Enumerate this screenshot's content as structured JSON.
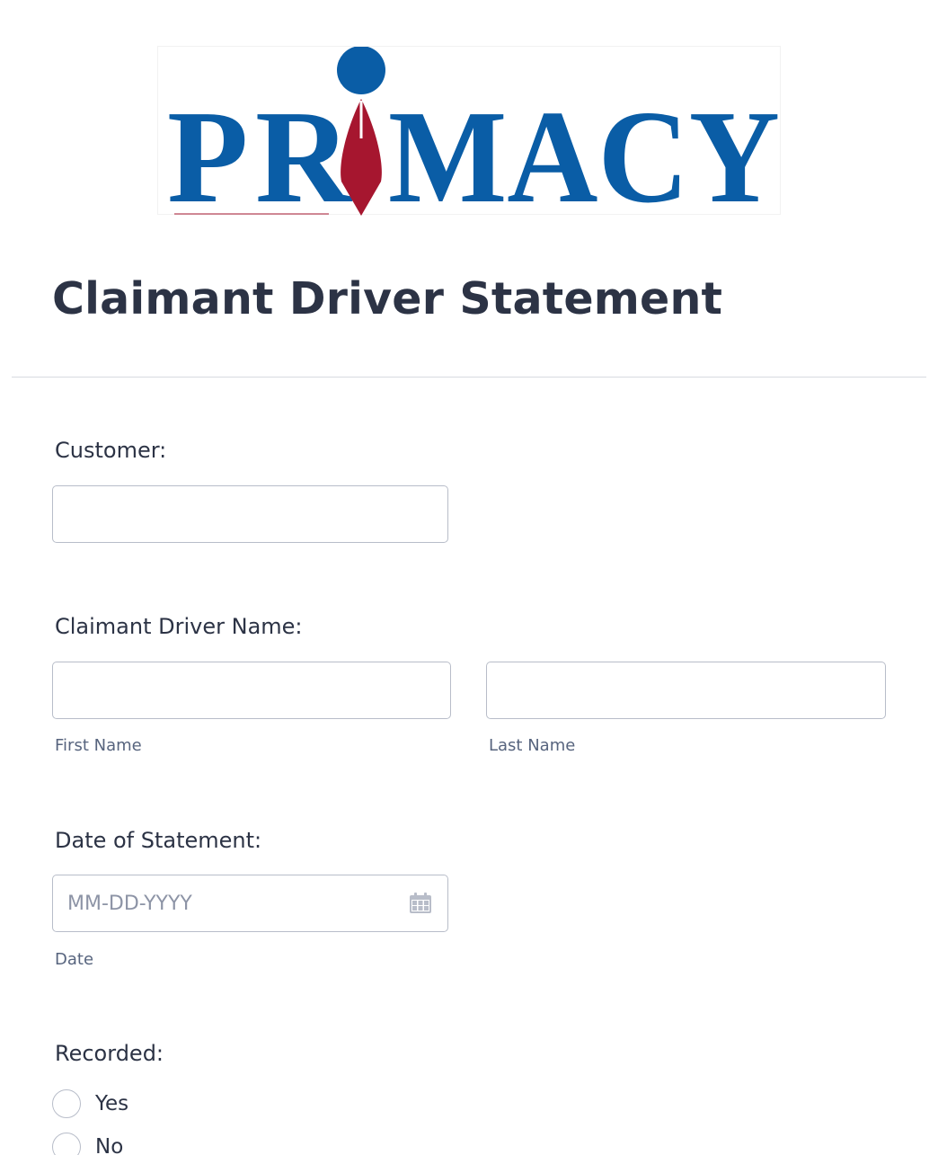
{
  "logo": {
    "text": "PRIMACY",
    "blue": "#0a5da6",
    "red": "#a6162f"
  },
  "form": {
    "title": "Claimant Driver Statement"
  },
  "customer": {
    "label": "Customer:",
    "value": ""
  },
  "claimant_name": {
    "label": "Claimant Driver Name:",
    "first_sublabel": "First Name",
    "last_sublabel": "Last Name",
    "first_value": "",
    "last_value": ""
  },
  "date_of_statement": {
    "label": "Date of Statement:",
    "placeholder": "MM-DD-YYYY",
    "sublabel": "Date",
    "icon": "calendar-icon"
  },
  "recorded": {
    "label": "Recorded:",
    "options": [
      {
        "label": "Yes",
        "selected": false
      },
      {
        "label": "No",
        "selected": false
      }
    ]
  },
  "colors": {
    "text": "#2c3345",
    "sublabel": "#57647e",
    "border": "#b8bdc9",
    "divider": "#d8dae0"
  }
}
